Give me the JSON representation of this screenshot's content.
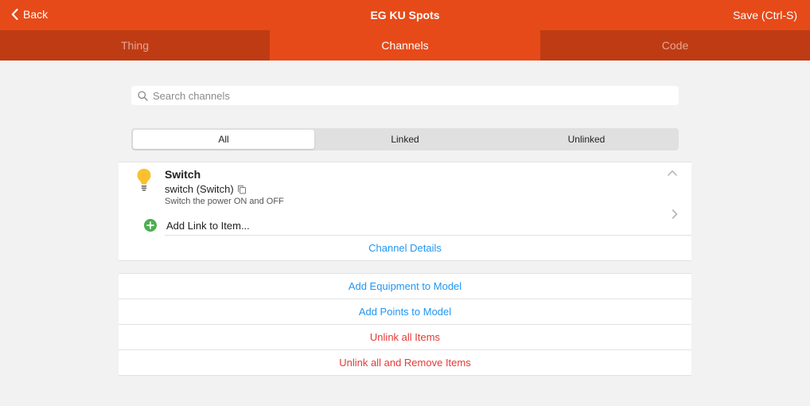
{
  "navbar": {
    "back_label": "Back",
    "title": "EG KU Spots",
    "save_label": "Save (Ctrl-S)"
  },
  "tabs": [
    {
      "label": "Thing",
      "active": false
    },
    {
      "label": "Channels",
      "active": true
    },
    {
      "label": "Code",
      "active": false
    }
  ],
  "search": {
    "placeholder": "Search channels",
    "value": ""
  },
  "filter": {
    "options": [
      "All",
      "Linked",
      "Unlinked"
    ],
    "selected": "All"
  },
  "channel": {
    "icon": "lightbulb-icon",
    "title": "Switch",
    "type": "switch (Switch)",
    "description": "Switch the power ON and OFF",
    "add_link_label": "Add Link to Item...",
    "details_label": "Channel Details"
  },
  "actions": [
    {
      "label": "Add Equipment to Model",
      "style": "blue"
    },
    {
      "label": "Add Points to Model",
      "style": "blue"
    },
    {
      "label": "Unlink all Items",
      "style": "red"
    },
    {
      "label": "Unlink all and Remove Items",
      "style": "red"
    }
  ],
  "colors": {
    "accent": "#e64a19",
    "accent_dark": "#bf3b13",
    "link_blue": "#2196f3",
    "danger_red": "#e53935",
    "bulb_yellow": "#fbc02d",
    "add_green": "#4caf50"
  }
}
